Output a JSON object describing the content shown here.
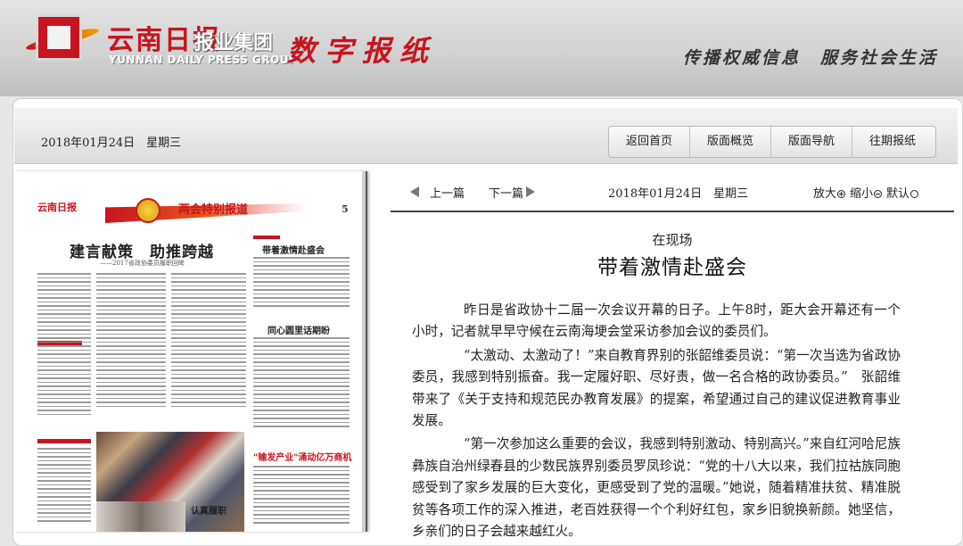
{
  "header": {
    "brand_cn": "云南日报",
    "brand_group": "报业集团",
    "brand_en": "YUNNAN DAILY PRESS GROUP",
    "product": "数字报纸",
    "slogan": "传播权威信息　服务社会生活"
  },
  "toolbar": {
    "date": "2018年01月24日　星期三",
    "nav": [
      "返回首页",
      "版面概览",
      "版面导航",
      "往期报纸"
    ]
  },
  "page_thumb": {
    "masthead": "云南日报",
    "special": "两会特别报道",
    "page_no": "5",
    "headline": "建言献策　助推跨越",
    "subhead": "——2017省政协委员履职回眸",
    "side_head1": "带着激情赴盛会",
    "side_head2": "同心圆里话期盼",
    "side_head3": "\"输发产业\"涌动亿万商机",
    "photo_caption": "认真履职"
  },
  "article_nav": {
    "prev": "上一篇",
    "next": "下一篇",
    "date": "2018年01月24日　星期三",
    "zoom_in": "放大",
    "zoom_out": "缩小",
    "zoom_default": "默认"
  },
  "article": {
    "kicker": "在现场",
    "title": "带着激情赴盛会",
    "paragraphs": [
      "昨日是省政协十二届一次会议开幕的日子。上午8时，距大会开幕还有一个小时，记者就早早守候在云南海埂会堂采访参加会议的委员们。",
      "“太激动、太激动了！”来自教育界别的张韶维委员说：“第一次当选为省政协委员，我感到特别振奋。我一定履好职、尽好责，做一名合格的政协委员。”　张韶维带来了《关于支持和规范民办教育发展》的提案，希望通过自己的建议促进教育事业发展。",
      "“第一次参加这么重要的会议，我感到特别激动、特别高兴。”来自红河哈尼族彝族自治州绿春县的少数民族界别委员罗凤珍说：“党的十八大以来，我们拉祜族同胞感受到了家乡发展的巨大变化，更感受到了党的温暖。”她说，随着精准扶贫、精准脱贫等各项工作的深入推进，老百姓获得一个个利好红包，家乡旧貌换新颜。她坚信，乡亲们的日子会越来越红火。"
    ]
  }
}
